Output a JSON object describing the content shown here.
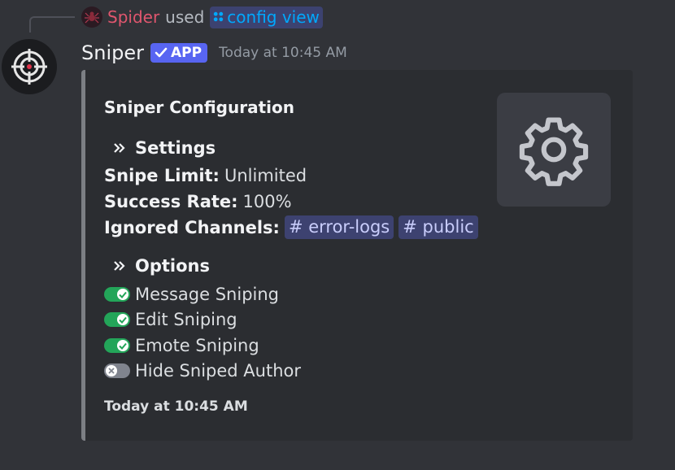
{
  "reply": {
    "user": "Spider",
    "used": "used",
    "command": "config view"
  },
  "message": {
    "author": "Sniper",
    "badge": "APP",
    "timestamp": "Today at 10:45 AM"
  },
  "embed": {
    "title": "Sniper Configuration",
    "settings_header": "Settings",
    "snipe_limit_label": "Snipe Limit:",
    "snipe_limit_value": "Unlimited",
    "success_rate_label": "Success Rate:",
    "success_rate_value": "100%",
    "ignored_label": "Ignored Channels:",
    "ignored_channels": [
      "error-logs",
      "public"
    ],
    "options_header": "Options",
    "options": [
      {
        "label": "Message Sniping",
        "enabled": true
      },
      {
        "label": "Edit Sniping",
        "enabled": true
      },
      {
        "label": "Emote Sniping",
        "enabled": true
      },
      {
        "label": "Hide Sniped Author",
        "enabled": false
      }
    ],
    "footer": "Today at 10:45 AM",
    "thumbnail_icon": "gear-icon"
  },
  "colors": {
    "background": "#313338",
    "embed": "#2b2d31",
    "accent": "#5865f2",
    "toggle_on": "#23a559",
    "toggle_off": "#80848e",
    "mention_bg": "#3d4270",
    "reply_user": "#e0566e",
    "command_text": "#00a8fc"
  }
}
